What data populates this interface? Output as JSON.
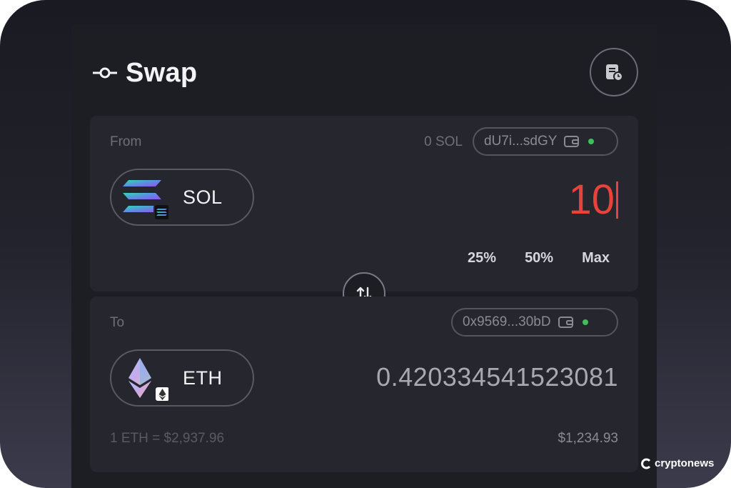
{
  "header": {
    "title": "Swap",
    "swap_icon": "swap-route-icon",
    "history_icon": "transaction-history-icon"
  },
  "from": {
    "label": "From",
    "balance": "0 SOL",
    "wallet_address": "dU7i...sdGY",
    "wallet_icon": "wallet-icon",
    "wallet_status": "connected",
    "token": {
      "symbol": "SOL",
      "icon": "solana-logo"
    },
    "amount": "10",
    "percent_options": [
      "25%",
      "50%",
      "Max"
    ]
  },
  "switch": {
    "icon": "swap-arrows-icon"
  },
  "to": {
    "label": "To",
    "wallet_address": "0x9569...30bD",
    "wallet_icon": "wallet-icon",
    "wallet_status": "connected",
    "token": {
      "symbol": "ETH",
      "icon": "ethereum-logo"
    },
    "amount": "0.420334541523081",
    "rate": "1 ETH = $2,937.96",
    "usd_value": "$1,234.93"
  },
  "watermark": {
    "text": "cryptonews"
  },
  "colors": {
    "accent_input": "#e8423a",
    "status_dot": "#3fbf5a",
    "card": "#26262e",
    "panel": "#1d1d24"
  }
}
